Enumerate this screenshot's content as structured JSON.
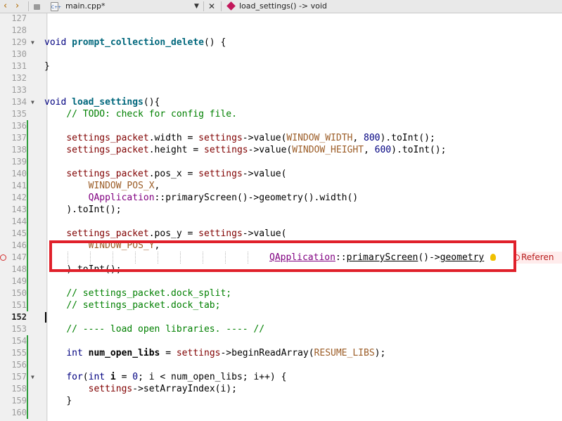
{
  "toolbar": {
    "back_icon": "chevron-left-icon",
    "forward_icon": "chevron-right-icon",
    "file_name": "main.cpp*",
    "file_icon_label": "C++",
    "close_label": "✕",
    "function_name": "load_settings() -> void"
  },
  "line_numbers": [
    "127",
    "128",
    "129",
    "130",
    "131",
    "132",
    "133",
    "134",
    "135",
    "136",
    "137",
    "138",
    "139",
    "140",
    "141",
    "142",
    "143",
    "144",
    "145",
    "146",
    "147",
    "148",
    "149",
    "150",
    "151",
    "152",
    "153",
    "154",
    "155",
    "156",
    "157",
    "158",
    "159",
    "160"
  ],
  "current_line": "152",
  "code": {
    "l129_kw": "void",
    "l129_fn": "prompt_collection_delete",
    "l129_rest": "() {",
    "l131": "}",
    "l134_kw": "void",
    "l134_fn": "load_settings",
    "l134_rest": "(){",
    "l135": "// TODO: check for config file.",
    "l137_a": "settings_packet",
    "l137_b": ".width = ",
    "l137_c": "settings",
    "l137_d": "->value(",
    "l137_e": "WINDOW_WIDTH",
    "l137_f": ", ",
    "l137_g": "800",
    "l137_h": ").toInt();",
    "l138_a": "settings_packet",
    "l138_b": ".height = ",
    "l138_c": "settings",
    "l138_d": "->value(",
    "l138_e": "WINDOW_HEIGHT",
    "l138_f": ", ",
    "l138_g": "600",
    "l138_h": ").toInt();",
    "l140_a": "settings_packet",
    "l140_b": ".pos_x = ",
    "l140_c": "settings",
    "l140_d": "->value(",
    "l141": "WINDOW_POS_X",
    "l141_b": ",",
    "l142_a": "QApplication",
    "l142_b": "::primaryScreen()->geometry().width()",
    "l143": ").toInt();",
    "l145_a": "settings_packet",
    "l145_b": ".pos_y = ",
    "l145_c": "settings",
    "l145_d": "->value(",
    "l146": "WINDOW_POS_Y",
    "l146_b": ",",
    "l147_a": "QApplication",
    "l147_b": "::",
    "l147_c": "primaryScreen",
    "l147_d": "()->",
    "l147_e": "geometry",
    "l147_err": "Referen",
    "l148": ").toInt();",
    "l150": "// settings_packet.dock_split;",
    "l151": "// settings_packet.dock_tab;",
    "l153": "// ---- load open libraries. ---- //",
    "l155_kw": "int",
    "l155_var": " num_open_libs",
    "l155_b": " = ",
    "l155_c": "settings",
    "l155_d": "->beginReadArray(",
    "l155_e": "RESUME_LIBS",
    "l155_f": ");",
    "l157_kw": "for",
    "l157_b": "(",
    "l157_kw2": "int",
    "l157_var": " i",
    "l157_c": " = ",
    "l157_num": "0",
    "l157_d": "; i < num_open_libs; i++) {",
    "l158_a": "settings",
    "l158_b": "->setArrayIndex(i);",
    "l159": "}"
  },
  "colors": {
    "error_red": "#e0202a",
    "change_bar": "#2e9c3b",
    "keyword": "#000080",
    "comment": "#008000",
    "member": "#800000",
    "constant": "#9c5d27",
    "class": "#800080"
  },
  "icons": {
    "lightbulb": "lightbulb-icon",
    "error": "error-circle-icon",
    "lock": "lock-icon",
    "dropdown": "chevron-down-icon"
  }
}
